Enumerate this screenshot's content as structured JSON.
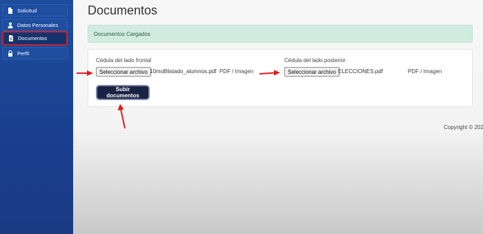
{
  "sidebar": {
    "items": [
      {
        "label": "Solicitud",
        "icon": "file-icon"
      },
      {
        "label": "Datos Personales",
        "icon": "user-icon"
      },
      {
        "label": "Documentos",
        "icon": "file-icon",
        "active": true
      },
      {
        "label": "Perfil",
        "icon": "lock-icon"
      }
    ]
  },
  "main": {
    "title": "Documentos",
    "alert": "Documentos Cargados",
    "uploads": [
      {
        "label": "Cédula del lado frontal",
        "button": "Seleccionar archivo",
        "file": "10moBlistado_alumnos.pdf",
        "hint": "PDF / Imagen"
      },
      {
        "label": "Cédula del lado posterior",
        "button": "Seleccionar archivo",
        "file": "ELECCIONES.pdf",
        "hint": "PDF / Imagen"
      }
    ],
    "submit_label": "Subir documentos"
  },
  "footer": {
    "text": "Copyright © 202"
  },
  "colors": {
    "sidebar": "#1d4e9e",
    "active_outline": "#c8232c",
    "alert_bg": "#d1ecdf",
    "submit_bg": "#1b2344",
    "annotation_arrow": "#e11b1b"
  }
}
